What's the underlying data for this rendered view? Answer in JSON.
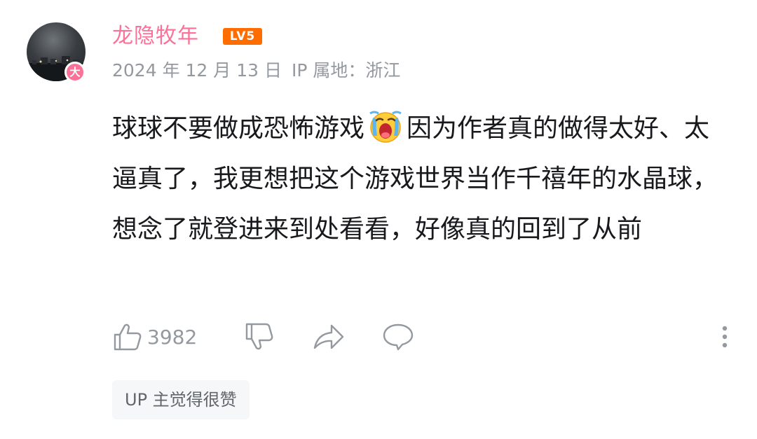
{
  "user": {
    "name": "龙隐牧年",
    "level": "LV5",
    "badge": "大"
  },
  "meta": {
    "date": "2024 年 12 月 13 日",
    "location": "IP 属地：浙江"
  },
  "comment": {
    "text_part1": "球球不要做成恐怖游戏",
    "emoji": "crying-face-emoji",
    "text_part2": "因为作者真的做得太好、太逼真了，我更想把这个游戏世界当作千禧年的水晶球，想念了就登进来到处看看，好像真的回到了从前"
  },
  "actions": {
    "like_count": "3982"
  },
  "tag": {
    "label": "UP 主觉得很赞"
  },
  "colors": {
    "username": "#fb7299",
    "level_badge": "#ff6c00",
    "meta_text": "#9499a0",
    "body_text": "#18191c",
    "tag_bg": "#f6f7f8"
  },
  "icons": [
    "like-icon",
    "dislike-icon",
    "share-icon",
    "reply-icon",
    "more-icon"
  ]
}
